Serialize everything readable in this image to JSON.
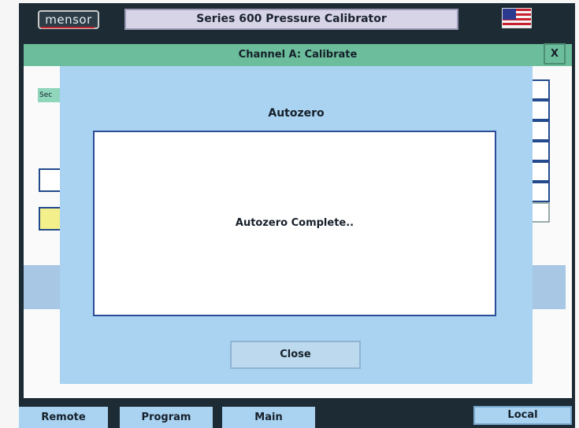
{
  "app": {
    "logo": "mensor",
    "title": "Series 600 Pressure Calibrator",
    "flag_icon": "us-flag-icon"
  },
  "window": {
    "title": "Channel A: Calibrate",
    "close_label": "X",
    "background_tag": "Sec"
  },
  "dialog": {
    "title": "Autozero",
    "message": "Autozero Complete..",
    "close_label": "Close"
  },
  "bottom_bar": {
    "remote_label": "Remote",
    "program_label": "Program",
    "main_label": "Main",
    "local_label": "Local"
  },
  "colors": {
    "header_green": "#6cbd9b",
    "dialog_blue": "#a9d3f1",
    "title_lavender": "#d6d4e6",
    "frame_dark": "#1d2b35"
  }
}
